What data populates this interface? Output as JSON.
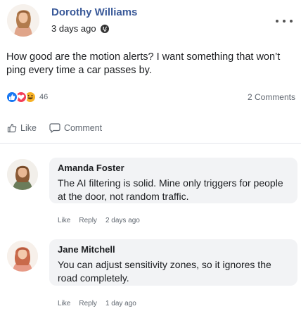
{
  "post": {
    "author": "Dorothy Williams",
    "time": "3 days ago",
    "text": "How good are the motion alerts? I want something that won’t ping every time a car passes by.",
    "reaction_count": "46",
    "comments_label": "2 Comments"
  },
  "actions": {
    "like": "Like",
    "comment": "Comment"
  },
  "comments": [
    {
      "author": "Amanda Foster",
      "text": "The AI filtering is solid. Mine only triggers for people at the door, not random traffic.",
      "like": "Like",
      "reply": "Reply",
      "time": "2 days ago"
    },
    {
      "author": "Jane Mitchell",
      "text": "You can adjust sensitivity zones, so it ignores the road completely.",
      "like": "Like",
      "reply": "Reply",
      "time": "1 day ago"
    }
  ],
  "colors": {
    "author_link": "#385898",
    "like_blue": "#1877f2",
    "love_red": "#f33e58",
    "haha_yellow": "#f7b125",
    "bubble": "#f2f3f5",
    "muted_text": "#606770"
  },
  "icons": [
    "avatar-dorothy",
    "globe-icon",
    "more-horizontal-icon",
    "like-reaction-icon",
    "love-reaction-icon",
    "haha-reaction-icon",
    "thumbs-up-icon",
    "comment-icon",
    "avatar-amanda",
    "avatar-jane"
  ]
}
